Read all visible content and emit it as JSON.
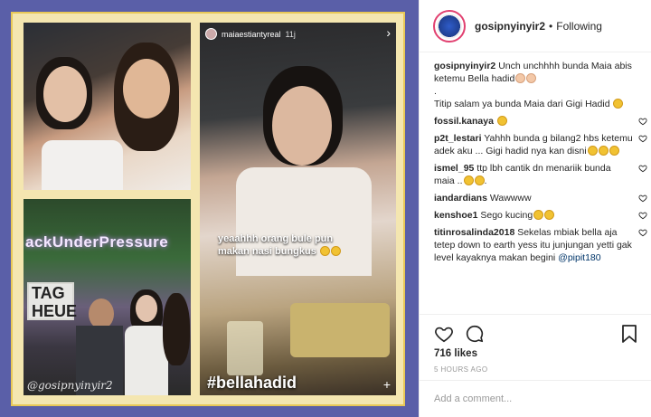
{
  "post": {
    "username": "gosipnyinyir2",
    "separator": "•",
    "follow_status": "Following",
    "likes": "716 likes",
    "timestamp": "5 HOURS AGO",
    "add_comment_placeholder": "Add a comment..."
  },
  "media": {
    "neon_text": "ackUnderPressure",
    "tag_logo": "TAG HEUE",
    "watermark": "@gosipnyinyir2",
    "story_user": "maiaestiantyreal",
    "story_time": "11j",
    "story_caption": "yeaahhh orang bule pun makan nasi bungkus",
    "story_hashtag": "#bellahadid"
  },
  "comments": [
    {
      "user": "gosipnyinyir2",
      "text": "Unch unchhhh bunda Maia abis ketemu Bella hadid",
      "emoji": [
        "hand",
        "hand"
      ],
      "extra_lines": [
        ".",
        "Titip salam ya bunda Maia dari Gigi Hadid"
      ],
      "extra_emoji": [
        "grin"
      ],
      "heart": false
    },
    {
      "user": "fossil.kanaya",
      "text": "",
      "emoji": [
        "heart-eyes"
      ],
      "heart": true
    },
    {
      "user": "p2t_lestari",
      "text": "Yahhh bunda g bilang2 hbs ketemu adek aku ... Gigi hadid nya kan disni",
      "emoji": [
        "grin",
        "grin",
        "grin"
      ],
      "heart": true
    },
    {
      "user": "ismel_95",
      "text": "ttp lbh cantik dn menariik bunda maia ..",
      "emoji": [
        "smile",
        "smile"
      ],
      "trail": ".",
      "heart": true
    },
    {
      "user": "iandardians",
      "text": "Wawwww",
      "emoji": [],
      "heart": true
    },
    {
      "user": "kenshoe1",
      "text": "Sego kucing",
      "emoji": [
        "grin",
        "wink"
      ],
      "heart": true
    },
    {
      "user": "titinrosalinda2018",
      "text": "Sekelas mbiak bella aja tetep down to earth yess itu junjungan yetti gak level kayaknya makan begini",
      "mention": "@pipit180",
      "emoji": [],
      "heart": true
    }
  ]
}
